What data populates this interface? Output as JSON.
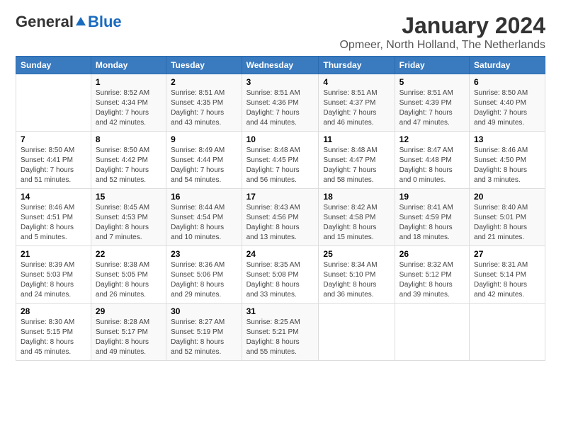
{
  "header": {
    "logo_general": "General",
    "logo_blue": "Blue",
    "month_title": "January 2024",
    "location": "Opmeer, North Holland, The Netherlands"
  },
  "days_of_week": [
    "Sunday",
    "Monday",
    "Tuesday",
    "Wednesday",
    "Thursday",
    "Friday",
    "Saturday"
  ],
  "weeks": [
    [
      {
        "day": "",
        "info": ""
      },
      {
        "day": "1",
        "info": "Sunrise: 8:52 AM\nSunset: 4:34 PM\nDaylight: 7 hours\nand 42 minutes."
      },
      {
        "day": "2",
        "info": "Sunrise: 8:51 AM\nSunset: 4:35 PM\nDaylight: 7 hours\nand 43 minutes."
      },
      {
        "day": "3",
        "info": "Sunrise: 8:51 AM\nSunset: 4:36 PM\nDaylight: 7 hours\nand 44 minutes."
      },
      {
        "day": "4",
        "info": "Sunrise: 8:51 AM\nSunset: 4:37 PM\nDaylight: 7 hours\nand 46 minutes."
      },
      {
        "day": "5",
        "info": "Sunrise: 8:51 AM\nSunset: 4:39 PM\nDaylight: 7 hours\nand 47 minutes."
      },
      {
        "day": "6",
        "info": "Sunrise: 8:50 AM\nSunset: 4:40 PM\nDaylight: 7 hours\nand 49 minutes."
      }
    ],
    [
      {
        "day": "7",
        "info": "Sunrise: 8:50 AM\nSunset: 4:41 PM\nDaylight: 7 hours\nand 51 minutes."
      },
      {
        "day": "8",
        "info": "Sunrise: 8:50 AM\nSunset: 4:42 PM\nDaylight: 7 hours\nand 52 minutes."
      },
      {
        "day": "9",
        "info": "Sunrise: 8:49 AM\nSunset: 4:44 PM\nDaylight: 7 hours\nand 54 minutes."
      },
      {
        "day": "10",
        "info": "Sunrise: 8:48 AM\nSunset: 4:45 PM\nDaylight: 7 hours\nand 56 minutes."
      },
      {
        "day": "11",
        "info": "Sunrise: 8:48 AM\nSunset: 4:47 PM\nDaylight: 7 hours\nand 58 minutes."
      },
      {
        "day": "12",
        "info": "Sunrise: 8:47 AM\nSunset: 4:48 PM\nDaylight: 8 hours\nand 0 minutes."
      },
      {
        "day": "13",
        "info": "Sunrise: 8:46 AM\nSunset: 4:50 PM\nDaylight: 8 hours\nand 3 minutes."
      }
    ],
    [
      {
        "day": "14",
        "info": "Sunrise: 8:46 AM\nSunset: 4:51 PM\nDaylight: 8 hours\nand 5 minutes."
      },
      {
        "day": "15",
        "info": "Sunrise: 8:45 AM\nSunset: 4:53 PM\nDaylight: 8 hours\nand 7 minutes."
      },
      {
        "day": "16",
        "info": "Sunrise: 8:44 AM\nSunset: 4:54 PM\nDaylight: 8 hours\nand 10 minutes."
      },
      {
        "day": "17",
        "info": "Sunrise: 8:43 AM\nSunset: 4:56 PM\nDaylight: 8 hours\nand 13 minutes."
      },
      {
        "day": "18",
        "info": "Sunrise: 8:42 AM\nSunset: 4:58 PM\nDaylight: 8 hours\nand 15 minutes."
      },
      {
        "day": "19",
        "info": "Sunrise: 8:41 AM\nSunset: 4:59 PM\nDaylight: 8 hours\nand 18 minutes."
      },
      {
        "day": "20",
        "info": "Sunrise: 8:40 AM\nSunset: 5:01 PM\nDaylight: 8 hours\nand 21 minutes."
      }
    ],
    [
      {
        "day": "21",
        "info": "Sunrise: 8:39 AM\nSunset: 5:03 PM\nDaylight: 8 hours\nand 24 minutes."
      },
      {
        "day": "22",
        "info": "Sunrise: 8:38 AM\nSunset: 5:05 PM\nDaylight: 8 hours\nand 26 minutes."
      },
      {
        "day": "23",
        "info": "Sunrise: 8:36 AM\nSunset: 5:06 PM\nDaylight: 8 hours\nand 29 minutes."
      },
      {
        "day": "24",
        "info": "Sunrise: 8:35 AM\nSunset: 5:08 PM\nDaylight: 8 hours\nand 33 minutes."
      },
      {
        "day": "25",
        "info": "Sunrise: 8:34 AM\nSunset: 5:10 PM\nDaylight: 8 hours\nand 36 minutes."
      },
      {
        "day": "26",
        "info": "Sunrise: 8:32 AM\nSunset: 5:12 PM\nDaylight: 8 hours\nand 39 minutes."
      },
      {
        "day": "27",
        "info": "Sunrise: 8:31 AM\nSunset: 5:14 PM\nDaylight: 8 hours\nand 42 minutes."
      }
    ],
    [
      {
        "day": "28",
        "info": "Sunrise: 8:30 AM\nSunset: 5:15 PM\nDaylight: 8 hours\nand 45 minutes."
      },
      {
        "day": "29",
        "info": "Sunrise: 8:28 AM\nSunset: 5:17 PM\nDaylight: 8 hours\nand 49 minutes."
      },
      {
        "day": "30",
        "info": "Sunrise: 8:27 AM\nSunset: 5:19 PM\nDaylight: 8 hours\nand 52 minutes."
      },
      {
        "day": "31",
        "info": "Sunrise: 8:25 AM\nSunset: 5:21 PM\nDaylight: 8 hours\nand 55 minutes."
      },
      {
        "day": "",
        "info": ""
      },
      {
        "day": "",
        "info": ""
      },
      {
        "day": "",
        "info": ""
      }
    ]
  ]
}
